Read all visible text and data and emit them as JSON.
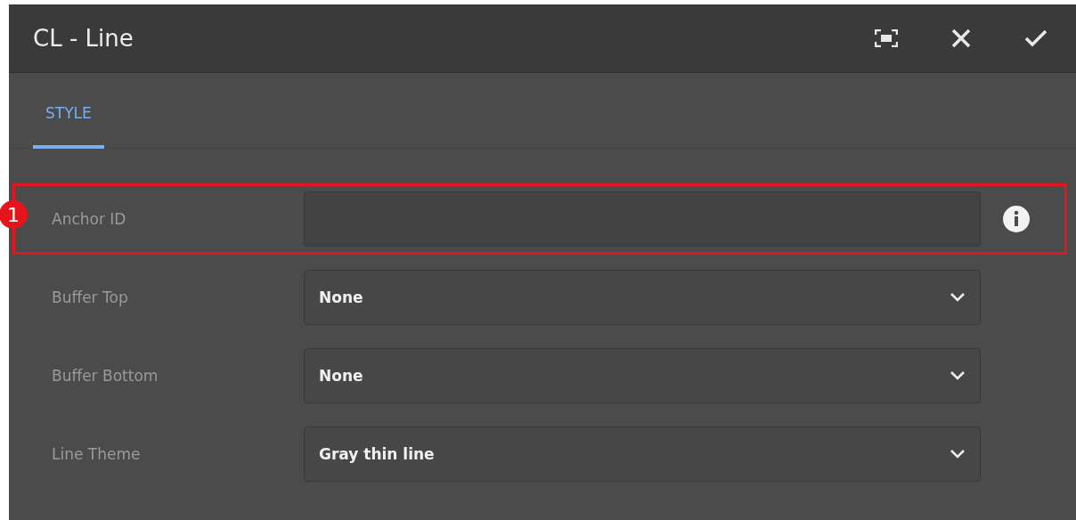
{
  "window": {
    "title": "CL - Line"
  },
  "tabs": [
    {
      "label": "STYLE",
      "selected": true
    }
  ],
  "fields": [
    {
      "kind": "text",
      "label": "Anchor ID",
      "highlighted": true,
      "callout": "1"
    },
    {
      "kind": "select",
      "label": "Buffer Top",
      "value": "None",
      "highlighted": false
    },
    {
      "kind": "select",
      "label": "Buffer Bottom",
      "value": "None",
      "highlighted": false
    },
    {
      "kind": "select",
      "label": "Line Theme",
      "value": "Gray thin line",
      "highlighted": false
    }
  ]
}
